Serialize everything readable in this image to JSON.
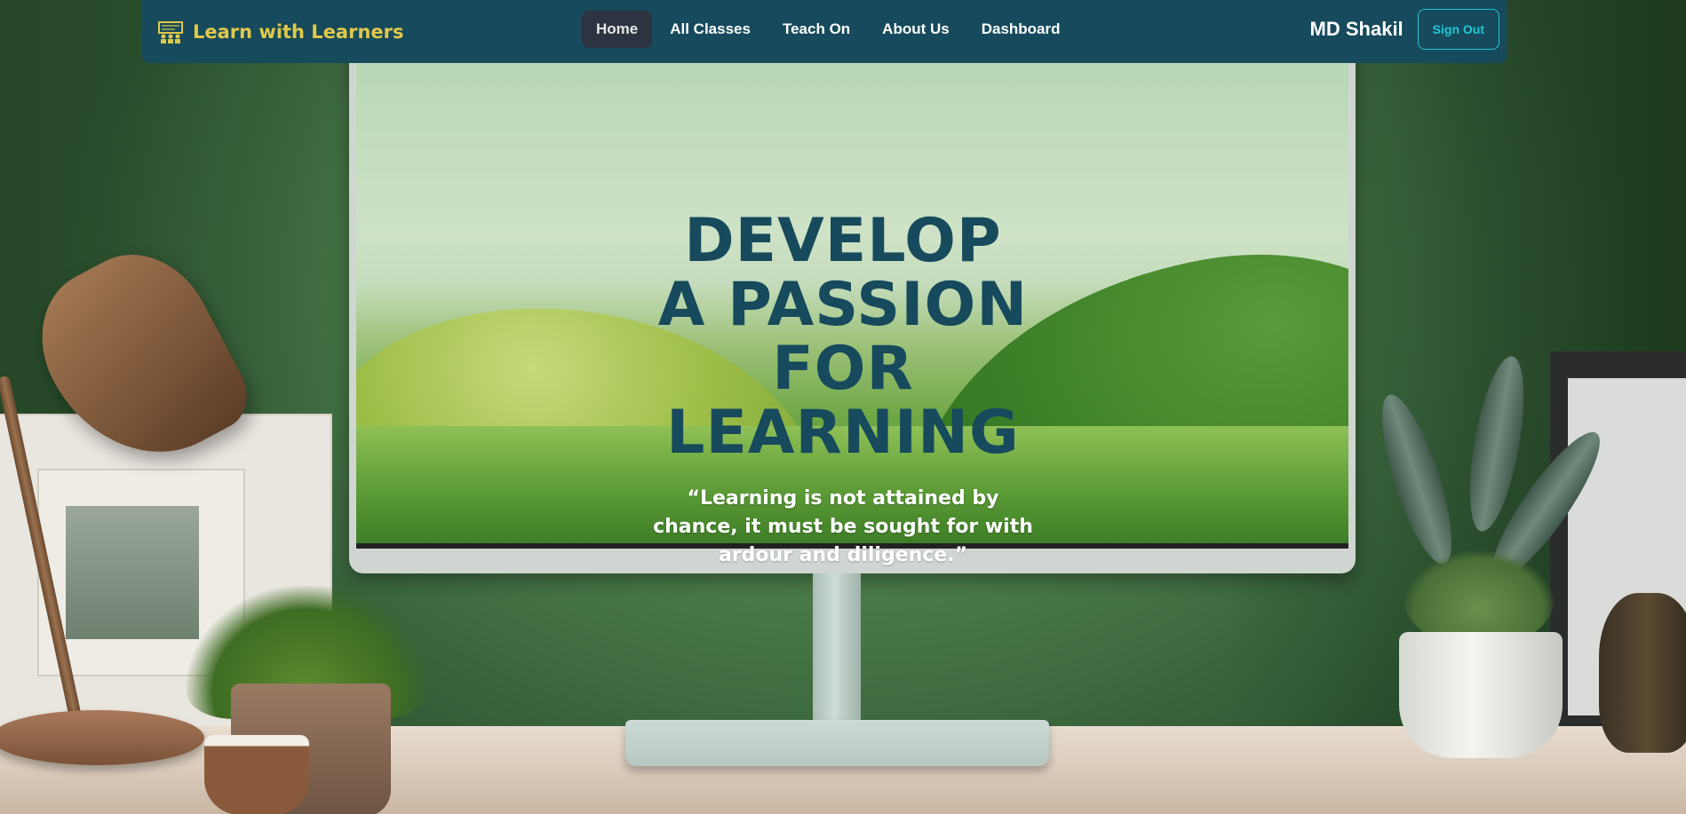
{
  "brand": {
    "name": "Learn with Learners",
    "icon": "classroom-icon",
    "color": "#e1c84a"
  },
  "nav": {
    "background": "#164a5c",
    "items": [
      {
        "label": "Home",
        "active": true
      },
      {
        "label": "All Classes",
        "active": false
      },
      {
        "label": "Teach On",
        "active": false
      },
      {
        "label": "About Us",
        "active": false
      },
      {
        "label": "Dashboard",
        "active": false
      }
    ]
  },
  "user": {
    "name": "MD Shakil",
    "signout_label": "Sign Out",
    "signout_color": "#22c7d6"
  },
  "hero": {
    "title": "DEVELOP A PASSION FOR LEARNING",
    "quote": "“Learning is not attained by chance, it must be sought for with ardour and diligence.”",
    "title_color": "#164a5c"
  }
}
